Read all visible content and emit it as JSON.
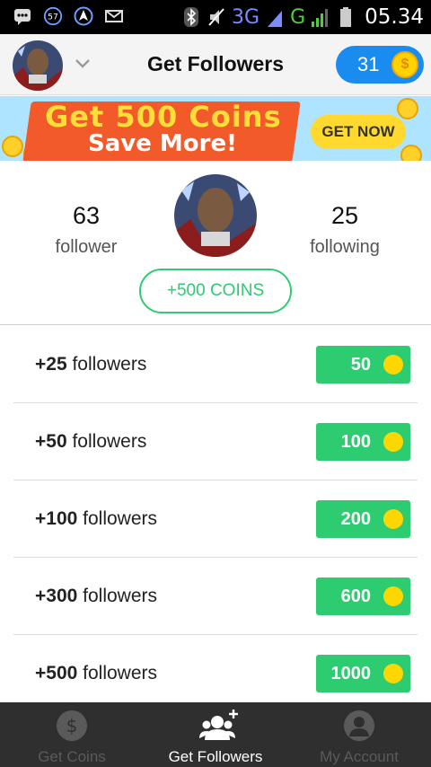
{
  "status_bar": {
    "notification_count": "57",
    "network_3g": "3G",
    "network_g": "G",
    "time": "05.34",
    "icons": [
      "bbm-icon",
      "notification-badge-icon",
      "navigation-icon",
      "email-icon",
      "bluetooth-icon",
      "mute-icon",
      "signal-icon",
      "battery-icon"
    ]
  },
  "header": {
    "title": "Get Followers",
    "coin_balance": "31",
    "coin_symbol": "$"
  },
  "banner": {
    "line1": "Get 500 Coins",
    "line2": "Save More!",
    "button": "GET NOW"
  },
  "profile": {
    "followers_count": "63",
    "followers_label": "follower",
    "following_count": "25",
    "following_label": "following",
    "bonus_button": "+500 COINS"
  },
  "packages": [
    {
      "amount": "+25",
      "unit": "followers",
      "price": "50"
    },
    {
      "amount": "+50",
      "unit": "followers",
      "price": "100"
    },
    {
      "amount": "+100",
      "unit": "followers",
      "price": "200"
    },
    {
      "amount": "+300",
      "unit": "followers",
      "price": "600"
    },
    {
      "amount": "+500",
      "unit": "followers",
      "price": "1000"
    }
  ],
  "tabs": [
    {
      "label": "Get Coins",
      "icon": "dollar-coin-icon",
      "active": false
    },
    {
      "label": "Get Followers",
      "icon": "add-followers-icon",
      "active": true
    },
    {
      "label": "My Account",
      "icon": "account-icon",
      "active": false
    }
  ],
  "colors": {
    "accent_green": "#2ecc71",
    "coin_pill_blue": "#1a8cf0",
    "coin_yellow": "#ffd700",
    "tab_bar": "#2f2f2f"
  }
}
